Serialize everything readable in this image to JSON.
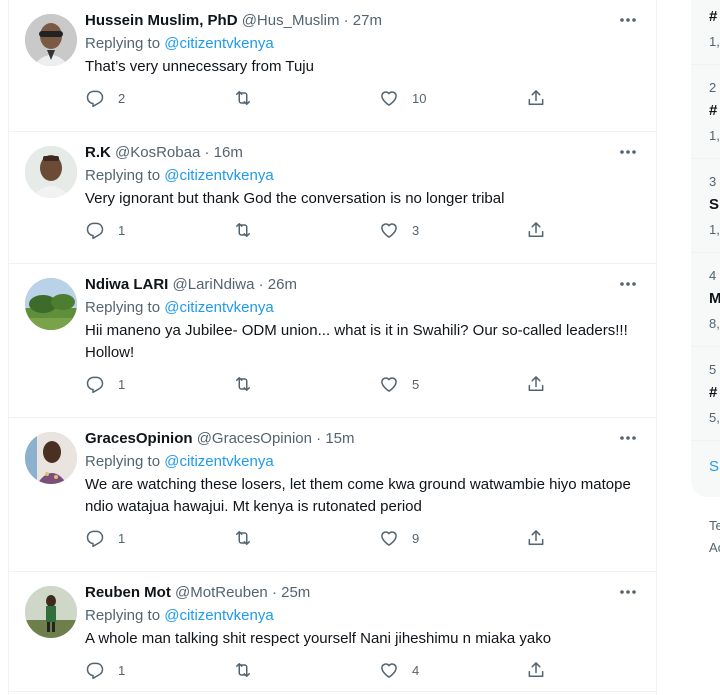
{
  "tweets": [
    {
      "name": "Hussein Muslim, PhD",
      "handle": "@Hus_Muslim",
      "time": "27m",
      "replying_label": "Replying to",
      "replying_to": "@citizentvkenya",
      "text": "That’s very unnecessary from Tuju",
      "replies": "2",
      "retweets": "",
      "likes": "10"
    },
    {
      "name": "R.K",
      "handle": "@KosRobaa",
      "time": "16m",
      "replying_label": "Replying to",
      "replying_to": "@citizentvkenya",
      "text": "Very ignorant but thank God the conversation is no longer tribal",
      "replies": "1",
      "retweets": "",
      "likes": "3"
    },
    {
      "name": "Ndiwa LARI",
      "handle": "@LariNdiwa",
      "time": "26m",
      "replying_label": "Replying to",
      "replying_to": "@citizentvkenya",
      "text": "Hii maneno ya Jubilee- ODM union... what is it in Swahili? Our so-called leaders!!! Hollow!",
      "replies": "1",
      "retweets": "",
      "likes": "5"
    },
    {
      "name": "GracesOpinion",
      "handle": "@GracesOpinion",
      "time": "15m",
      "replying_label": "Replying to",
      "replying_to": "@citizentvkenya",
      "text": "We are watching these losers, let them come kwa ground watwambie hiyo matope ndio watajua hawajui. Mt kenya is rutonated period",
      "replies": "1",
      "retweets": "",
      "likes": "9"
    },
    {
      "name": "Reuben Mot",
      "handle": "@MotReuben",
      "time": "25m",
      "replying_label": "Replying to",
      "replying_to": "@citizentvkenya",
      "text": "A whole man talking shit respect yourself Nani jiheshimu n miaka yako",
      "replies": "1",
      "retweets": "",
      "likes": "4"
    }
  ],
  "sidebar": {
    "t1_name": "#",
    "t1_count": "1,",
    "t2_rank": "2",
    "t2_name": "#",
    "t2_count": "1,",
    "t3_rank": "3",
    "t3_name": "Sl",
    "t3_count": "1,",
    "t4_rank": "4",
    "t4_name": "M",
    "t4_count": "8,",
    "t5_rank": "5",
    "t5_name": "#",
    "t5_count": "5,",
    "show_more": "Sl",
    "footer1": "Te",
    "footer2": "Ac"
  }
}
